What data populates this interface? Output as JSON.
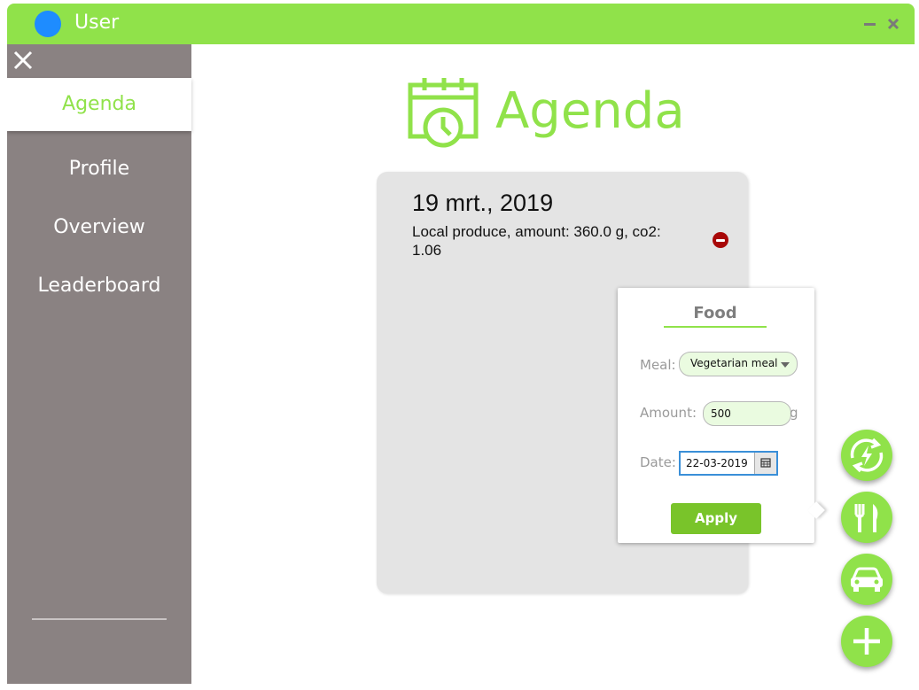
{
  "window": {
    "title": "User",
    "accent_color": "#90e24a",
    "avatar_color": "#1e8cff",
    "minimize_icon": "minimize-icon",
    "close_icon": "close-icon"
  },
  "sidebar": {
    "close_icon": "close-icon",
    "items": [
      {
        "label": "Agenda",
        "active": true
      },
      {
        "label": "Profile",
        "active": false
      },
      {
        "label": "Overview",
        "active": false
      },
      {
        "label": "Leaderboard",
        "active": false
      }
    ]
  },
  "main": {
    "heading": "Agenda",
    "heading_icon": "calendar-clock-icon",
    "entries": [
      {
        "date": "19 mrt., 2019",
        "description": "Local produce, amount: 360.0 g, co2: 1.06",
        "remove_icon": "remove-icon"
      }
    ]
  },
  "food_form": {
    "title": "Food",
    "meal_label": "Meal:",
    "meal_value": "Vegetarian meal",
    "amount_label": "Amount:",
    "amount_value": "500",
    "amount_unit": "g",
    "date_label": "Date:",
    "date_value": "22-03-2019",
    "apply_label": "Apply"
  },
  "fabs": [
    {
      "icon": "energy-icon"
    },
    {
      "icon": "food-icon"
    },
    {
      "icon": "car-icon"
    },
    {
      "icon": "add-icon"
    }
  ]
}
